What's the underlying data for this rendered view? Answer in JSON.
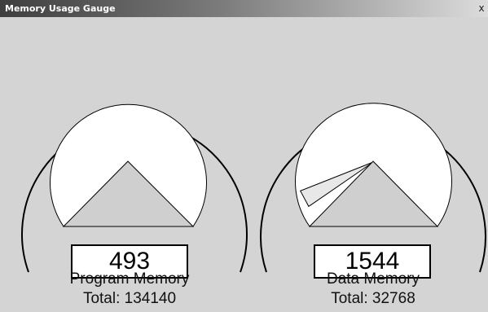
{
  "window": {
    "title": "Memory Usage Gauge",
    "close_glyph": "x"
  },
  "gauges": [
    {
      "name": "Program Memory",
      "value": "493",
      "total_label": "Total: 134140",
      "used_fraction": 0.0037
    },
    {
      "name": "Data Memory",
      "value": "1544",
      "total_label": "Total: 32768",
      "used_fraction": 0.047
    }
  ],
  "colors": {
    "background": "#d4d4d4",
    "dial_face": "#ffffff",
    "needle_fill": "#cfcfcf",
    "usage_fill": "#e8e8e8"
  }
}
